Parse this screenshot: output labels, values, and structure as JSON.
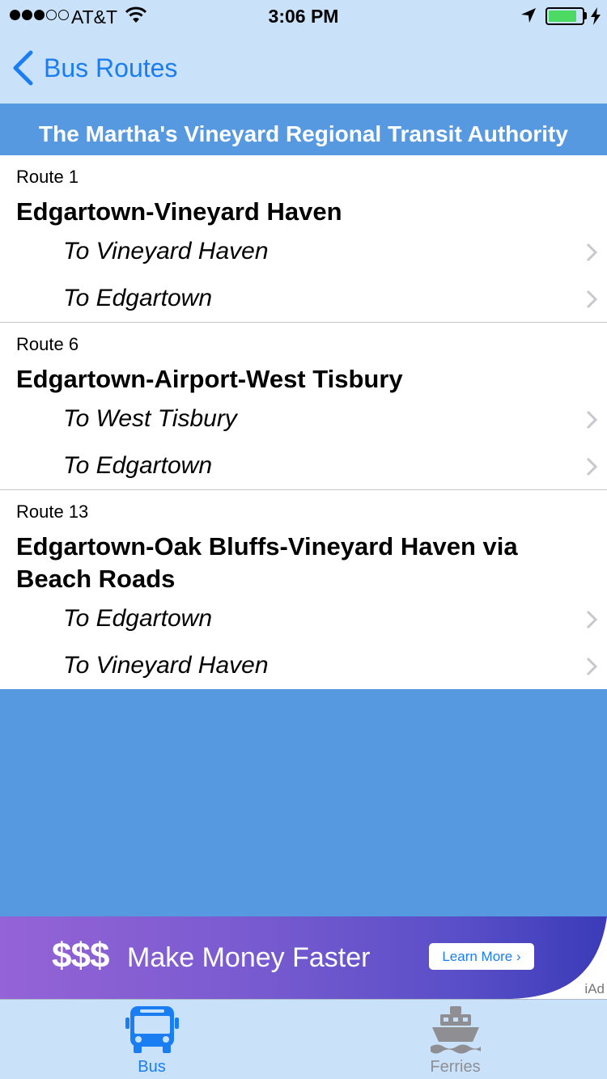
{
  "status_bar": {
    "carrier": "AT&T",
    "time": "3:06 PM",
    "signal_bars_filled": 3,
    "signal_bars_total": 5,
    "battery_level": 0.85
  },
  "nav": {
    "back_label": "Bus Routes"
  },
  "header": {
    "title": "The Martha's Vineyard Regional Transit Authority"
  },
  "routes": [
    {
      "number": "Route 1",
      "name": "Edgartown-Vineyard Haven",
      "directions": [
        "To Vineyard Haven",
        "To Edgartown"
      ]
    },
    {
      "number": "Route 6",
      "name": "Edgartown-Airport-West Tisbury",
      "directions": [
        "To West Tisbury",
        "To Edgartown"
      ]
    },
    {
      "number": "Route 13",
      "name": "Edgartown-Oak Bluffs-Vineyard Haven via Beach Roads",
      "directions": [
        "To Edgartown",
        "To Vineyard Haven"
      ]
    }
  ],
  "ad": {
    "dollars": "$$$",
    "text": "Make Money Faster",
    "button": "Learn More",
    "badge": "iAd"
  },
  "tabs": [
    {
      "label": "Bus",
      "icon": "bus-icon",
      "selected": true
    },
    {
      "label": "Ferries",
      "icon": "ferry-icon",
      "selected": false
    }
  ],
  "colors": {
    "accent": "#1a7ef2",
    "nav_background": "#c9e2fa",
    "section_background": "#5699e0",
    "battery_fill": "#4cd964"
  }
}
